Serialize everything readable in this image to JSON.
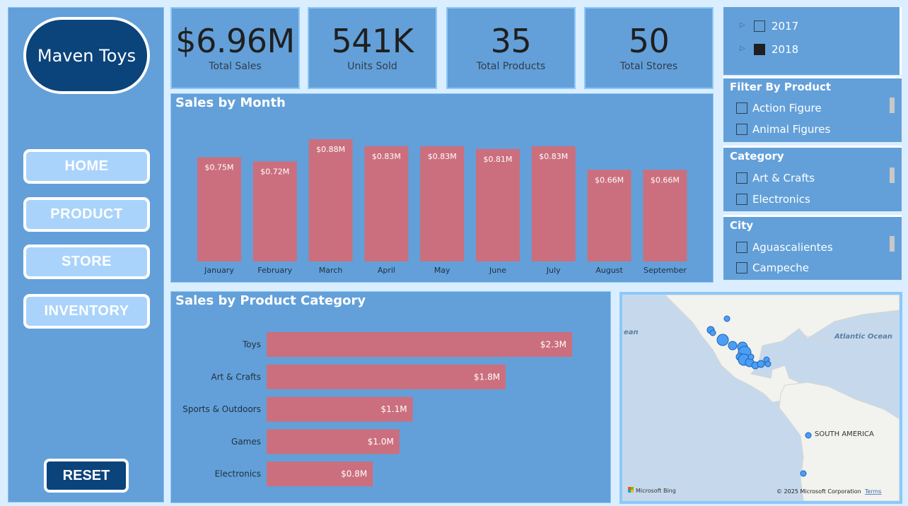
{
  "sidebar": {
    "logo_text": "Maven Toys",
    "nav": [
      {
        "label": "HOME"
      },
      {
        "label": "PRODUCT"
      },
      {
        "label": "STORE"
      },
      {
        "label": "INVENTORY"
      }
    ],
    "reset_label": "RESET"
  },
  "kpis": [
    {
      "value": "$6.96M",
      "label": "Total Sales"
    },
    {
      "value": "541K",
      "label": "Units Sold"
    },
    {
      "value": "35",
      "label": "Total Products"
    },
    {
      "value": "50",
      "label": "Total Stores"
    }
  ],
  "year_slicer": {
    "options": [
      {
        "label": "2017",
        "checked": false
      },
      {
        "label": "2018",
        "checked": true
      }
    ]
  },
  "product_slicer": {
    "title": "Filter By Product",
    "options": [
      "Action Figure",
      "Animal Figures"
    ]
  },
  "category_slicer": {
    "title": "Category",
    "options": [
      "Art & Crafts",
      "Electronics"
    ]
  },
  "city_slicer": {
    "title": "City",
    "options": [
      "Aguascalientes",
      "Campeche"
    ]
  },
  "map": {
    "labels": {
      "ocean_left": "ean",
      "atlantic": "Atlantic Ocean",
      "south_america": "SOUTH AMERICA"
    },
    "attribution": {
      "brand": "Microsoft Bing",
      "copyright": "© 2025 Microsoft Corporation",
      "terms": "Terms"
    },
    "colors": {
      "bubble": "#4a9ff5",
      "land": "#f2f2ee",
      "water": "#c6d9ec"
    }
  },
  "chart_data": [
    {
      "type": "bar",
      "title": "Sales by Month",
      "categories": [
        "January",
        "February",
        "March",
        "April",
        "May",
        "June",
        "July",
        "August",
        "September"
      ],
      "values": [
        0.75,
        0.72,
        0.88,
        0.83,
        0.83,
        0.81,
        0.83,
        0.66,
        0.66
      ],
      "data_labels": [
        "$0.75M",
        "$0.72M",
        "$0.88M",
        "$0.83M",
        "$0.83M",
        "$0.81M",
        "$0.83M",
        "$0.66M",
        "$0.66M"
      ],
      "ylim": [
        0,
        0.88
      ],
      "color": "#cb6f7e",
      "grid": false
    },
    {
      "type": "bar",
      "orientation": "horizontal",
      "title": "Sales by Product Category",
      "categories": [
        "Toys",
        "Art & Crafts",
        "Sports & Outdoors",
        "Games",
        "Electronics"
      ],
      "values": [
        2.3,
        1.8,
        1.1,
        1.0,
        0.8
      ],
      "data_labels": [
        "$2.3M",
        "$1.8M",
        "$1.1M",
        "$1.0M",
        "$0.8M"
      ],
      "xlim": [
        0,
        2.3
      ],
      "color": "#cb6f7e",
      "grid": false
    }
  ]
}
